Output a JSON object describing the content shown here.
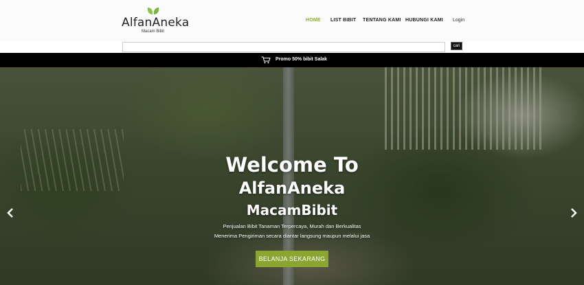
{
  "brand": {
    "name": "AlfanAneka",
    "tagline": "Macam Bibit",
    "leaf_icon": "leaf-icon",
    "accent_color": "#8bae2e"
  },
  "nav": {
    "items": [
      {
        "label": "HOME",
        "active": true
      },
      {
        "label": "LIST BIBIT",
        "active": false
      },
      {
        "label": "TENTANG KAMI",
        "active": false
      },
      {
        "label": "HUBUNGI KAMI",
        "active": false
      }
    ],
    "login": "Login"
  },
  "search": {
    "value": "",
    "placeholder": "",
    "button_label": "cari"
  },
  "promo": {
    "icon": "cart-icon",
    "text": "Promo 50% bibit Salak"
  },
  "hero": {
    "line1": "Welcome To",
    "line2": "AlfanAneka",
    "line3": "MacamBibit",
    "desc1": "Penjualan Bibit Tanaman Terpercaya, Murah dan Berkualitas",
    "desc2": "Menerima Pengiriman secara diantar langsung maupun melalui jasa",
    "cta_label": "BELANJA SEKARANG",
    "cta_color": "#8aa530",
    "prev_icon": "chevron-left-icon",
    "next_icon": "chevron-right-icon"
  }
}
